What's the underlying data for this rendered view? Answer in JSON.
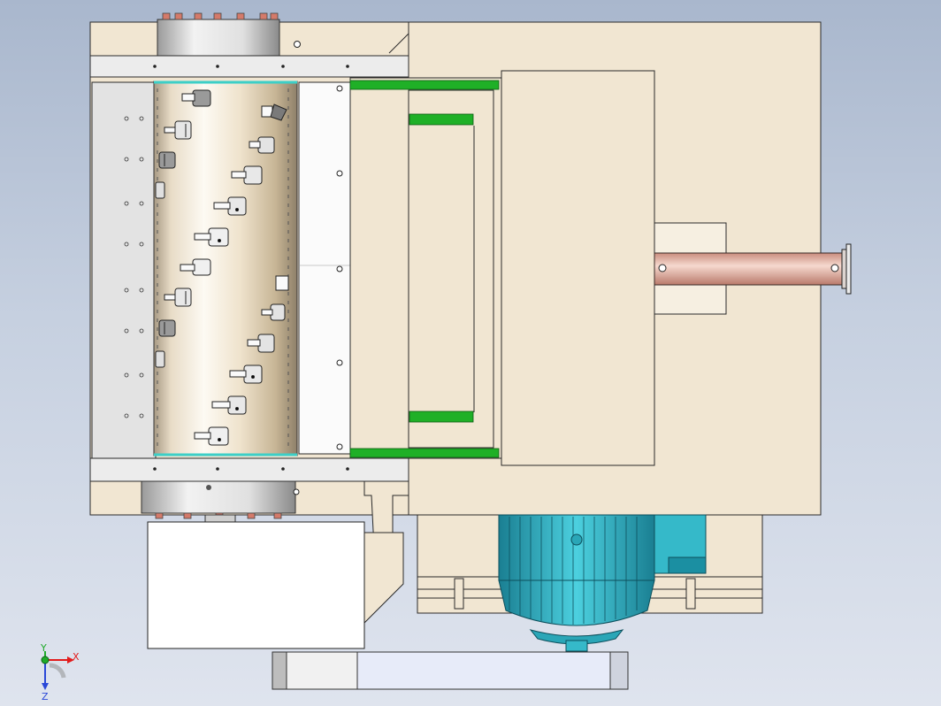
{
  "view": {
    "background_top": "#a9b7cd",
    "background_bottom": "#dfe4ee"
  },
  "colors": {
    "frame": "#f1e6d2",
    "frame_stroke": "#2a2a2a",
    "plate": "#e9e9e9",
    "drum_light": "#fbf7ef",
    "drum_dark": "#bfae94",
    "hub": "#d9d9d9",
    "green_bar": "#1fb027",
    "shaft": "#e7b6a8",
    "motor": "#35b9c9",
    "motor_dark": "#1b7f93",
    "base": "#e7ebf9",
    "white_box": "#ffffff"
  },
  "triad": {
    "x_label": "X",
    "y_label": "Y",
    "z_label": "Z",
    "x_color": "#e21b1b",
    "y_color": "#1faa2a",
    "z_color": "#2a48d8"
  }
}
